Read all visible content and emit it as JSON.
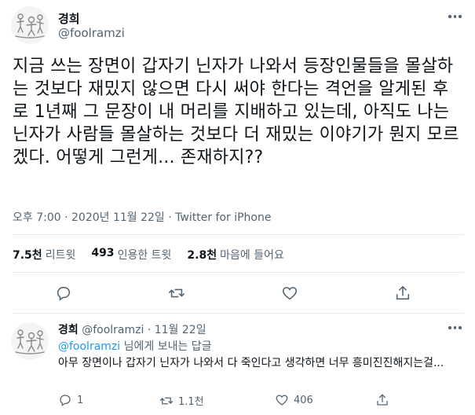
{
  "tweet": {
    "name": "경희",
    "handle": "@foolramzi",
    "text": "지금 쓰는 장면이 갑자기 닌자가 나와서 등장인물들을 몰살하는 것보다 재밌지 않으면 다시 써야 한다는 격언을 알게된 후로 1년째 그 문장이 내 머리를 지배하고 있는데, 아직도 나는 닌자가 사람들 몰살하는 것보다 더 재밌는 이야기가 뭔지 모르겠다. 어떻게 그런게... 존재하지??",
    "time": "오후 7:00 · 2020년 11월 22일 · Twitter for iPhone",
    "stats": {
      "retweets_count": "7.5천",
      "retweets_label": "리트윗",
      "quotes_count": "493",
      "quotes_label": "인용한 트윗",
      "likes_count": "2.8천",
      "likes_label": "마음에 들어요"
    }
  },
  "reply": {
    "name": "경희",
    "meta": "@foolramzi · 11월 22일",
    "replying_handle": "@foolramzi",
    "replying_suffix": " 님에게 보내는 답글",
    "text": "아무 장면이나 갑자기 닌자가 나와서 다 죽인다고 생각하면 너무 흥미진진해지는걸...",
    "reply_count": "1",
    "retweet_count": "1.1천",
    "like_count": "406"
  },
  "colors": {
    "text": "#0f1419",
    "secondary": "#536471",
    "link": "#1d9bf0",
    "divider": "#e6ecf0"
  }
}
